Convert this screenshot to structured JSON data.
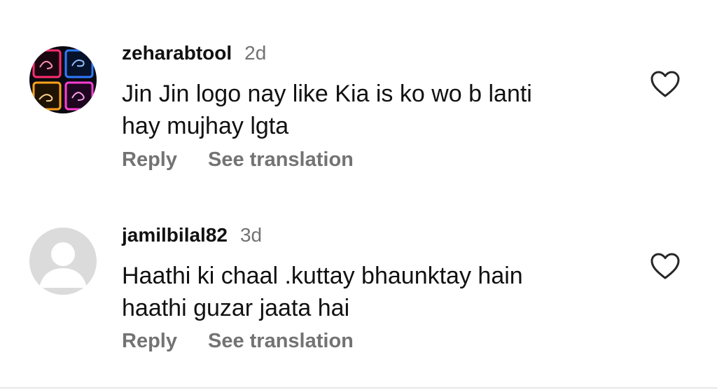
{
  "comments": [
    {
      "username": "zeharabtool",
      "age": "2d",
      "text": "Jin Jin logo nay like Kia is ko wo b lanti\nhay mujhay lgta",
      "reply_label": "Reply",
      "translate_label": "See translation",
      "avatar_icon": "neon-calligraphy-avatar",
      "like_icon": "heart-outline-icon"
    },
    {
      "username": "jamilbilal82",
      "age": "3d",
      "text": "Haathi ki chaal .kuttay bhaunktay hain\nhaathi guzar jaata hai",
      "reply_label": "Reply",
      "translate_label": "See translation",
      "avatar_icon": "default-profile-avatar",
      "like_icon": "heart-outline-icon"
    }
  ],
  "colors": {
    "primary_text": "#111111",
    "secondary_text": "#737373",
    "default_avatar_bg": "#dbdbdb",
    "background": "#ffffff"
  }
}
